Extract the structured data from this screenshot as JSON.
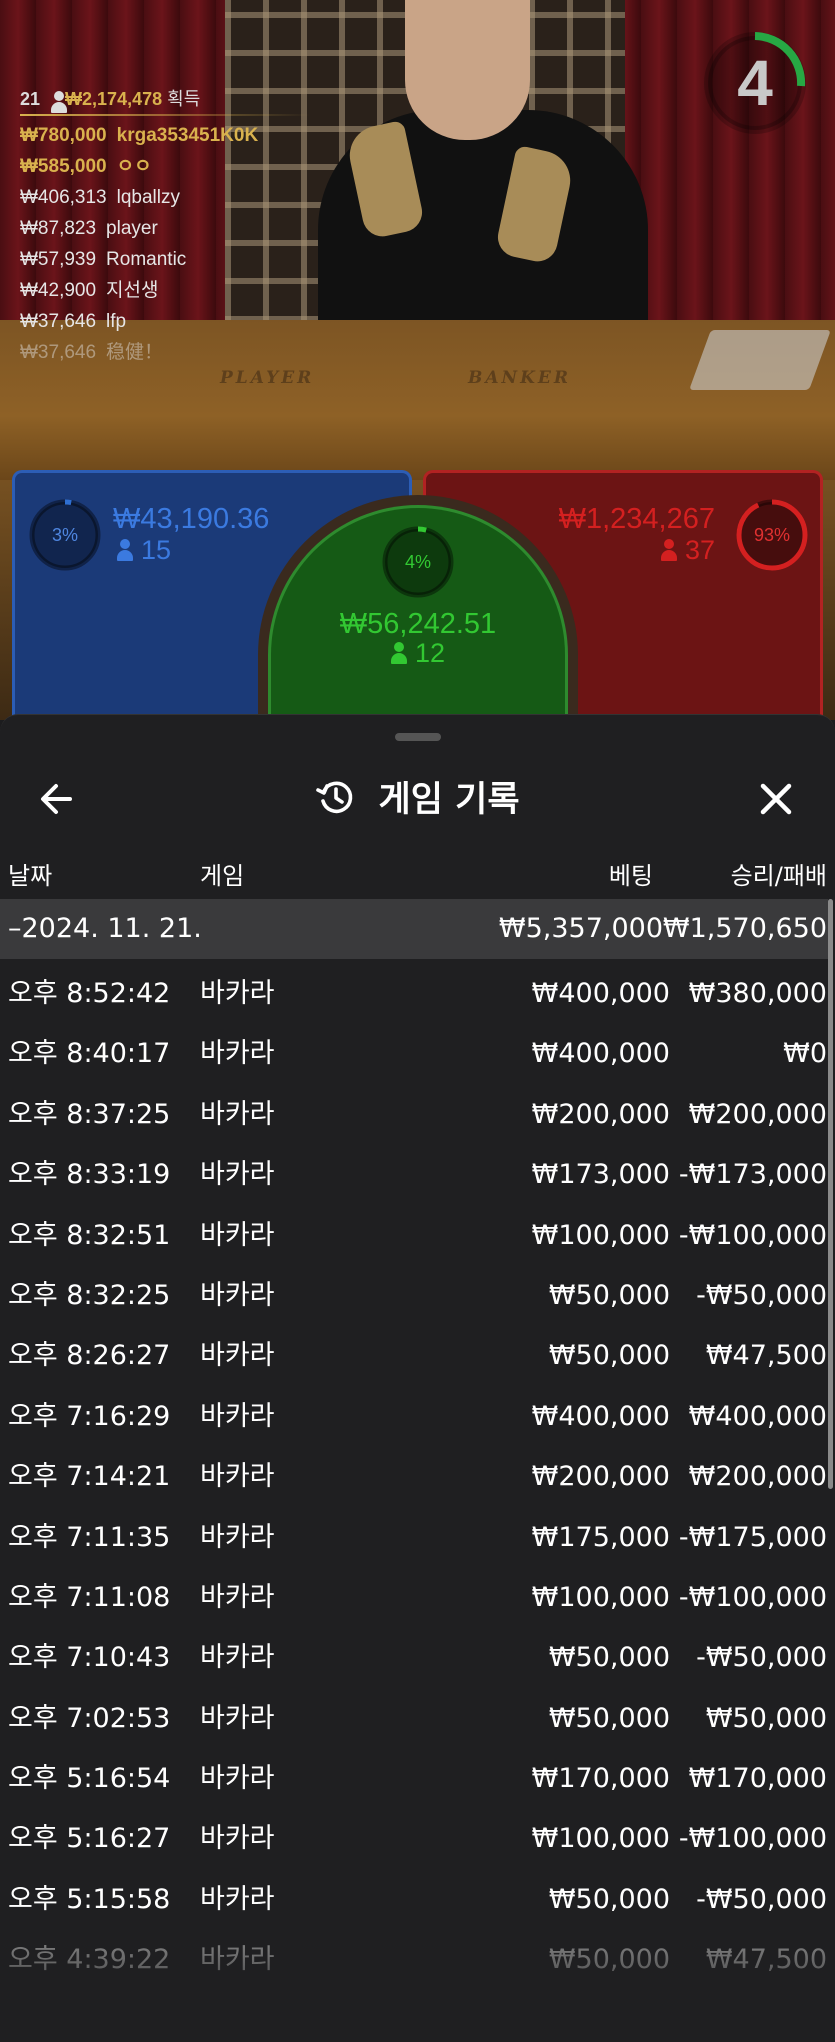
{
  "video": {
    "timer": "4",
    "table_labels": {
      "player": "PLAYER",
      "banker": "BANKER"
    },
    "winners_header": {
      "count": "21",
      "amount": "₩2,174,478",
      "suffix": "획득"
    },
    "winners": [
      {
        "amount": "₩780,000",
        "name": "krga353451K0K"
      },
      {
        "amount": "₩585,000",
        "name": "ㅇㅇ"
      },
      {
        "amount": "₩406,313",
        "name": "lqballzy"
      },
      {
        "amount": "₩87,823",
        "name": "player"
      },
      {
        "amount": "₩57,939",
        "name": "Romantic"
      },
      {
        "amount": "₩42,900",
        "name": "지선생"
      },
      {
        "amount": "₩37,646",
        "name": "lfp"
      },
      {
        "amount": "₩37,646",
        "name": "稳健！"
      }
    ]
  },
  "bets": {
    "player": {
      "percent": "3%",
      "percent_value": 0.03,
      "amount": "₩43,190.36",
      "count": "15",
      "color": "#2f6fd1"
    },
    "tie": {
      "percent": "4%",
      "percent_value": 0.04,
      "amount": "₩56,242.51",
      "count": "12",
      "color": "#32c832"
    },
    "banker": {
      "percent": "93%",
      "percent_value": 0.93,
      "amount": "₩1,234,267",
      "count": "37",
      "color": "#d42020"
    }
  },
  "history": {
    "title": "게임 기록",
    "columns": {
      "date": "날짜",
      "game": "게임",
      "bet": "베팅",
      "result": "승리/패배"
    },
    "summary": {
      "date": "–2024. 11. 21.",
      "bet": "₩5,357,000",
      "result": "₩1,570,650"
    },
    "rows": [
      {
        "time": "오후 8:52:42",
        "game": "바카라",
        "bet": "₩400,000",
        "result": "₩380,000"
      },
      {
        "time": "오후 8:40:17",
        "game": "바카라",
        "bet": "₩400,000",
        "result": "₩0"
      },
      {
        "time": "오후 8:37:25",
        "game": "바카라",
        "bet": "₩200,000",
        "result": "₩200,000"
      },
      {
        "time": "오후 8:33:19",
        "game": "바카라",
        "bet": "₩173,000",
        "result": "-₩173,000"
      },
      {
        "time": "오후 8:32:51",
        "game": "바카라",
        "bet": "₩100,000",
        "result": "-₩100,000"
      },
      {
        "time": "오후 8:32:25",
        "game": "바카라",
        "bet": "₩50,000",
        "result": "-₩50,000"
      },
      {
        "time": "오후 8:26:27",
        "game": "바카라",
        "bet": "₩50,000",
        "result": "₩47,500"
      },
      {
        "time": "오후 7:16:29",
        "game": "바카라",
        "bet": "₩400,000",
        "result": "₩400,000"
      },
      {
        "time": "오후 7:14:21",
        "game": "바카라",
        "bet": "₩200,000",
        "result": "₩200,000"
      },
      {
        "time": "오후 7:11:35",
        "game": "바카라",
        "bet": "₩175,000",
        "result": "-₩175,000"
      },
      {
        "time": "오후 7:11:08",
        "game": "바카라",
        "bet": "₩100,000",
        "result": "-₩100,000"
      },
      {
        "time": "오후 7:10:43",
        "game": "바카라",
        "bet": "₩50,000",
        "result": "-₩50,000"
      },
      {
        "time": "오후 7:02:53",
        "game": "바카라",
        "bet": "₩50,000",
        "result": "₩50,000"
      },
      {
        "time": "오후 5:16:54",
        "game": "바카라",
        "bet": "₩170,000",
        "result": "₩170,000"
      },
      {
        "time": "오후 5:16:27",
        "game": "바카라",
        "bet": "₩100,000",
        "result": "-₩100,000"
      },
      {
        "time": "오후 5:15:58",
        "game": "바카라",
        "bet": "₩50,000",
        "result": "-₩50,000"
      },
      {
        "time": "오후 4:39:22",
        "game": "바카라",
        "bet": "₩50,000",
        "result": "₩47,500"
      }
    ]
  },
  "icons": {
    "back": "arrow-left-icon",
    "history": "history-icon",
    "close": "close-icon",
    "person": "person-icon"
  }
}
